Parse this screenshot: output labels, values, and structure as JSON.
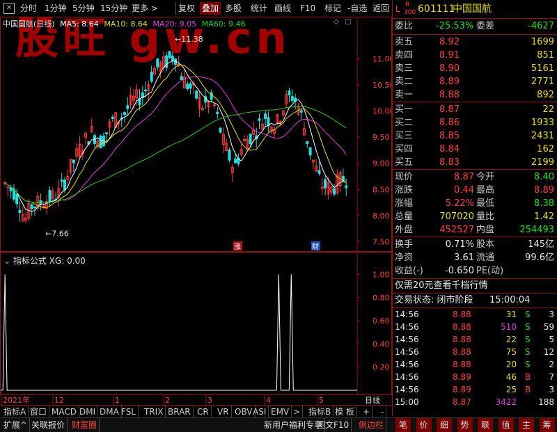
{
  "toolbar": {
    "items": [
      "分时",
      "1分钟",
      "5分钟",
      "15分钟",
      "更多 >",
      "复权",
      "叠加",
      "多股",
      "统计",
      "画线",
      "F10",
      "标记",
      "-自选",
      "返回"
    ],
    "active": "叠加",
    "watermark": "股旺 gw.cn"
  },
  "main_legend": {
    "title": "中国国航(日线)",
    "ma5": "MA5: 8.64",
    "ma10": "MA10: 8.64",
    "ma20": "MA20: 9.05",
    "ma60": "MA60: 9.46"
  },
  "chart_data": [
    {
      "type": "candlestick",
      "title": "中国国航(日线)",
      "y_ticks": [
        "11.00",
        "10.50",
        "10.00",
        "9.50",
        "9.00",
        "8.50",
        "8.00",
        "7.50"
      ],
      "ylim": [
        7.4,
        11.55
      ],
      "annotations": {
        "high": "11.38",
        "low": "7.66",
        "markers": [
          "涨",
          "财"
        ]
      },
      "x_ticks": [
        "2021年",
        "12",
        "1",
        "2",
        "3",
        "4",
        "5"
      ],
      "x_label_right": "日线",
      "ma_lines": [
        "MA5",
        "MA10",
        "MA20",
        "MA60"
      ]
    },
    {
      "type": "line",
      "title": "指标公式 XG: 0.00",
      "y_ticks": [
        "1.00",
        "0.80",
        "0.60",
        "0.40",
        "0.20"
      ],
      "ylim": [
        0,
        1.08
      ],
      "spikes_at_fraction": [
        0.012,
        0.78,
        0.815
      ]
    }
  ],
  "indicator": {
    "legend": "指标公式 XG: 0.00",
    "y_ticks": [
      "1.00",
      "0.80",
      "0.60",
      "0.40",
      "0.20"
    ]
  },
  "xaxis": {
    "labels": [
      "2021年",
      "12",
      "1",
      "2",
      "3",
      "4",
      "5"
    ],
    "right_label": "日线"
  },
  "stock": {
    "prefix_l": "L",
    "prefix_r": "R",
    "prefix_code": "300",
    "code": "601111",
    "name": "中国国航"
  },
  "weibi": {
    "label1": "委比",
    "value1": "-25.53%",
    "label2": "委差",
    "value2": "-4627"
  },
  "asks": [
    {
      "label": "卖五",
      "price": "8.92",
      "vol": "1699"
    },
    {
      "label": "卖四",
      "price": "8.91",
      "vol": "851"
    },
    {
      "label": "卖三",
      "price": "8.90",
      "vol": "5161"
    },
    {
      "label": "卖二",
      "price": "8.89",
      "vol": "2771"
    },
    {
      "label": "卖一",
      "price": "8.88",
      "vol": "892"
    }
  ],
  "bids": [
    {
      "label": "买一",
      "price": "8.87",
      "vol": "22"
    },
    {
      "label": "买二",
      "price": "8.86",
      "vol": "1933"
    },
    {
      "label": "买三",
      "price": "8.85",
      "vol": "2431"
    },
    {
      "label": "买四",
      "price": "8.84",
      "vol": "162"
    },
    {
      "label": "买五",
      "price": "8.83",
      "vol": "2199"
    }
  ],
  "quote": [
    {
      "l1": "现价",
      "v1": "8.87",
      "l2": "今开",
      "v2": "8.40"
    },
    {
      "l1": "涨跌",
      "v1": "0.44",
      "l2": "最高",
      "v2": "8.89"
    },
    {
      "l1": "涨幅",
      "v1": "5.22%",
      "l2": "最低",
      "v2": "8.38"
    },
    {
      "l1": "总量",
      "v1": "707020",
      "l2": "量比",
      "v2": "1.42"
    },
    {
      "l1": "外盘",
      "v1": "452527",
      "l2": "内盘",
      "v2": "254493"
    }
  ],
  "fin": [
    {
      "l1": "换手",
      "v1": "0.71%",
      "l2": "股本",
      "v2": "145亿"
    },
    {
      "l1": "净资",
      "v1": "3.61",
      "l2": "流通",
      "v2": "99.6亿"
    },
    {
      "l1": "收益(-)",
      "v1": "-0.650",
      "l2": "PE(动)",
      "v2": ""
    }
  ],
  "promo": "仅需20元查看千档行情",
  "trade_status": {
    "label": "交易状态: 闭市阶段",
    "time": "15:00:04"
  },
  "ticks": [
    {
      "t": "14:56",
      "p": "8.88",
      "v": "31",
      "s": "S",
      "n": "3"
    },
    {
      "t": "14:56",
      "p": "8.88",
      "v": "510",
      "s": "S",
      "n": "59"
    },
    {
      "t": "14:56",
      "p": "8.88",
      "v": "22",
      "s": "S",
      "n": "5"
    },
    {
      "t": "14:56",
      "p": "8.88",
      "v": "75",
      "s": "S",
      "n": "12"
    },
    {
      "t": "14:56",
      "p": "8.88",
      "v": "20",
      "s": "S",
      "n": "2"
    },
    {
      "t": "14:56",
      "p": "8.89",
      "v": "46",
      "s": "B",
      "n": "7"
    },
    {
      "t": "14:56",
      "p": "8.89",
      "v": "25",
      "s": "B",
      "n": "3"
    },
    {
      "t": "15:00",
      "p": "8.87",
      "v": "3422",
      "s": "",
      "n": "188"
    }
  ],
  "indicator_tabs": [
    "指标A",
    "窗口",
    "MACD",
    "DMI",
    "DMA",
    "FSL",
    "TRIX",
    "BRAR",
    "CR",
    "VR",
    "OBV",
    "ASI",
    "EMV",
    ">",
    "指标B",
    "模 板",
    "+",
    "-"
  ],
  "status_left": [
    "扩展^",
    "关联报价",
    "财富圈"
  ],
  "status_right": [
    "新用户福利专享",
    "图文F10",
    "侧边栏"
  ],
  "right_tabs": [
    "笔",
    "价",
    "细",
    "势",
    "联",
    "值",
    "主",
    "筹"
  ],
  "colors": {
    "up": "#ff3c3c",
    "down": "#20e0e0",
    "ma5": "#ffffff",
    "ma10": "#e8e000",
    "ma20": "#e040e0",
    "ma60": "#20d020",
    "frame": "#9a1010"
  }
}
